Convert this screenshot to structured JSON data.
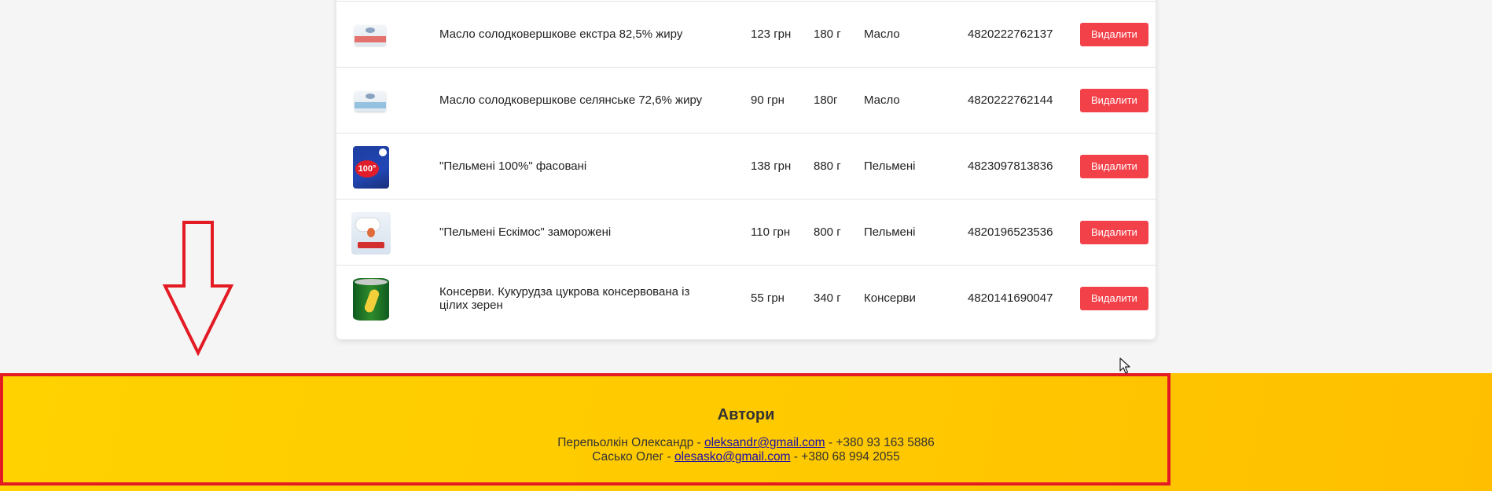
{
  "table": {
    "delete_label": "Видалити",
    "rows": [
      {
        "name": "Масло солодковершкове екстра 82,5% жиру",
        "price": "123 грн",
        "weight": "180 г",
        "category": "Масло",
        "code": "4820222762137",
        "image": "butter-red-pack"
      },
      {
        "name": "Масло солодковершкове селянське 72,6% жиру",
        "price": "90 грн",
        "weight": "180г",
        "category": "Масло",
        "code": "4820222762144",
        "image": "butter-blue-pack"
      },
      {
        "name": "\"Пельмені 100%\" фасовані",
        "price": "138 грн",
        "weight": "880 г",
        "category": "Пельмені",
        "code": "4823097813836",
        "image": "pelmeni-100-bag"
      },
      {
        "name": "\"Пельмені Ескімос\" заморожені",
        "price": "110 грн",
        "weight": "800 г",
        "category": "Пельмені",
        "code": "4820196523536",
        "image": "pelmeni-eskimos-bag"
      },
      {
        "name": "Консерви. Кукурудза цукрова консервована із цілих зерен",
        "price": "55 грн",
        "weight": "340 г",
        "category": "Консерви",
        "code": "4820141690047",
        "image": "corn-can"
      }
    ]
  },
  "footer": {
    "title": "Автори",
    "authors": [
      {
        "name": "Перепьолкін Олександр - ",
        "email": "oleksandr@gmail.com",
        "phone": " - +380 93 163 5886"
      },
      {
        "name": "Сасько Олег - ",
        "email": "olesasko@gmail.com",
        "phone": " - +380 68 994 2055"
      }
    ]
  },
  "colors": {
    "accent_red": "#e31b25",
    "delete_button": "#f3414a",
    "footer_yellow": "#ffcc00"
  },
  "icons": {
    "annotation": "down-arrow-outline",
    "cursor": "mouse-pointer"
  }
}
